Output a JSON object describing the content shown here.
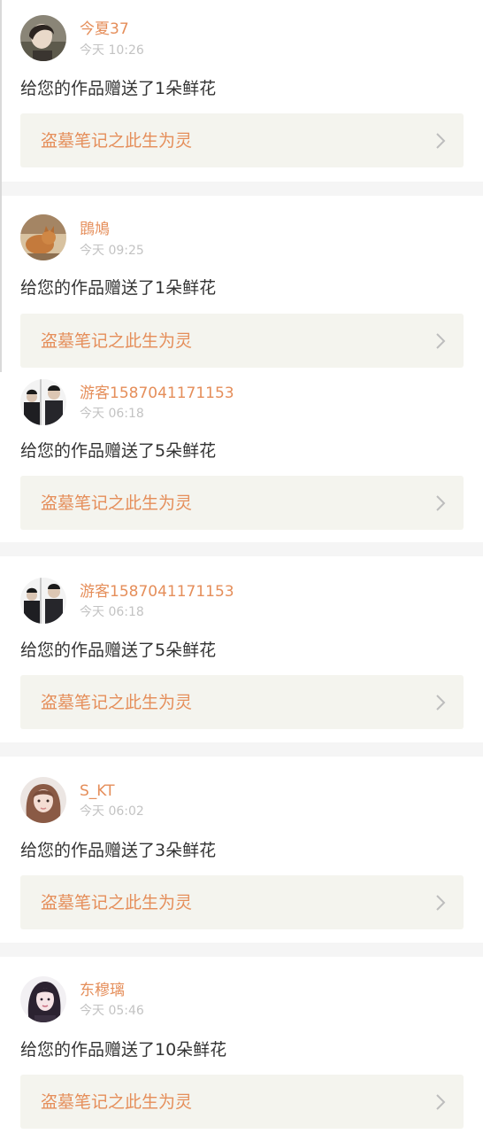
{
  "feed": {
    "items": [
      {
        "username": "今夏37",
        "time": "今天 10:26",
        "message": "给您的作品赠送了1朵鲜花",
        "work_title": "盗墓笔记之此生为灵",
        "avatar_icon": "portrait-dark-hair-avatar"
      },
      {
        "username": "鵾鳩",
        "time": "今天 09:25",
        "message": "给您的作品赠送了1朵鲜花",
        "work_title": "盗墓笔记之此生为灵",
        "avatar_icon": "cat-photo-avatar"
      },
      {
        "username": "游客1587041171153",
        "time": "今天 06:18",
        "message": "给您的作品赠送了5朵鲜花",
        "work_title": "盗墓笔记之此生为灵",
        "avatar_icon": "two-men-in-suits-avatar"
      },
      {
        "username": "游客1587041171153",
        "time": "今天 06:18",
        "message": "给您的作品赠送了5朵鲜花",
        "work_title": "盗墓笔记之此生为灵",
        "avatar_icon": "two-men-in-suits-avatar"
      },
      {
        "username": "S_KT",
        "time": "今天 06:02",
        "message": "给您的作品赠送了3朵鲜花",
        "work_title": "盗墓笔记之此生为灵",
        "avatar_icon": "girl-portrait-avatar"
      },
      {
        "username": "东穆璃",
        "time": "今天 05:46",
        "message": "给您的作品赠送了10朵鲜花",
        "work_title": "盗墓笔记之此生为灵",
        "avatar_icon": "woman-portrait-avatar"
      }
    ]
  },
  "colors": {
    "accent": "#e58e5a",
    "text": "#333333",
    "muted": "#c3c3c3",
    "link_background": "#f4f4ee",
    "page_background": "#f5f5f5"
  }
}
